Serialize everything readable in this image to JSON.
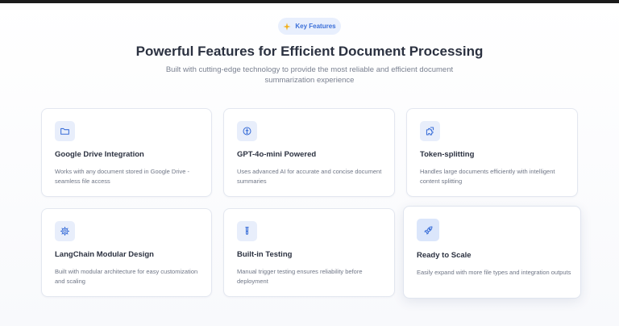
{
  "header": {
    "badge_label": "Key Features",
    "title": "Powerful Features for Efficient Document Processing",
    "subtitle": "Built with cutting-edge technology to provide the most reliable and efficient document summarization experience"
  },
  "features": [
    {
      "icon": "folder-icon",
      "title": "Google Drive Integration",
      "description": "Works with any document stored in Google Drive - seamless file access"
    },
    {
      "icon": "ai-chip-icon",
      "title": "GPT-4o-mini Powered",
      "description": "Uses advanced AI for accurate and concise document summaries"
    },
    {
      "icon": "puzzle-icon",
      "title": "Token-splitting",
      "description": "Handles large documents efficiently with intelligent content splitting"
    },
    {
      "icon": "gear-icon",
      "title": "LangChain Modular Design",
      "description": "Built with modular architecture for easy customization and scaling"
    },
    {
      "icon": "test-tube-icon",
      "title": "Built-in Testing",
      "description": "Manual trigger testing ensures reliability before deployment"
    },
    {
      "icon": "rocket-icon",
      "title": "Ready to Scale",
      "description": "Easily expand with more file types and integration outputs"
    }
  ],
  "colors": {
    "accent": "#3b6fd8",
    "badge_bg": "#e8effd",
    "icon_bg": "#e8eefb",
    "title_text": "#2b3140",
    "body_text": "#6f7686"
  }
}
